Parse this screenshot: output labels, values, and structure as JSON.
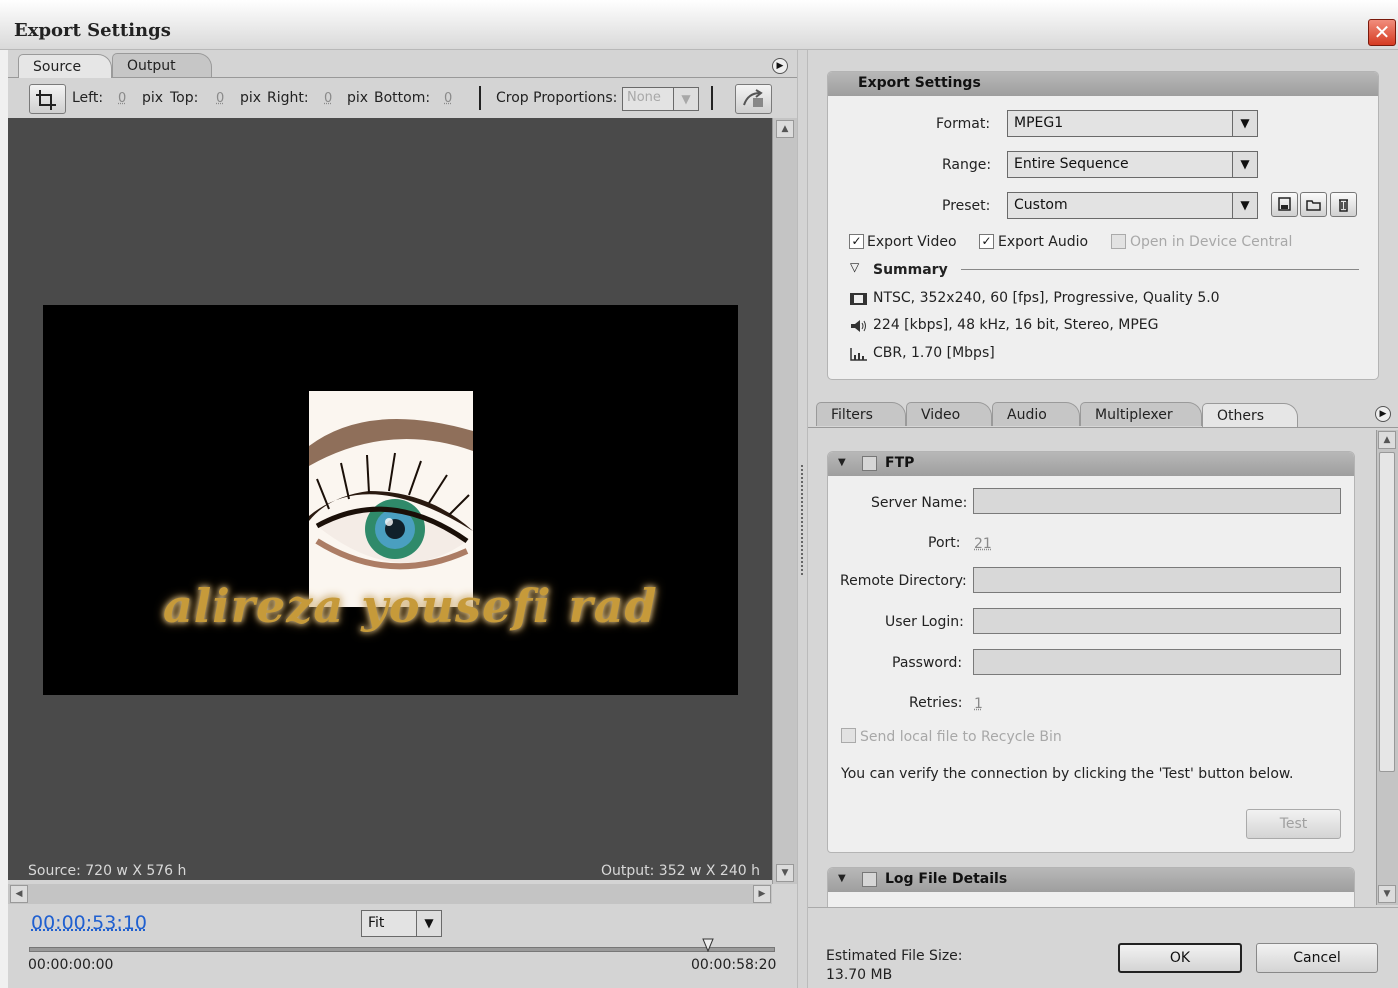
{
  "window": {
    "title": "Export Settings",
    "close_label": "✕"
  },
  "left": {
    "tabs": [
      {
        "label": "Source",
        "active": true
      },
      {
        "label": "Output",
        "active": false
      }
    ],
    "crop": {
      "left_label": "Left:",
      "left_value": "0",
      "pix1": "pix",
      "top_label": "Top:",
      "top_value": "0",
      "pix2": "pix",
      "right_label": "Right:",
      "right_value": "0",
      "pix3": "pix",
      "bottom_label": "Bottom:",
      "bottom_value": "0",
      "proportions_label": "Crop Proportions:",
      "proportions_value": "None"
    },
    "preview": {
      "watermark": "alireza yousefi rad",
      "source_info": "Source: 720 w X 576 h",
      "output_info": "Output: 352 w X 240 h"
    },
    "timeline": {
      "current_time": "00:00:53:10",
      "zoom_value": "Fit",
      "start_time": "00:00:00:00",
      "end_time": "00:00:58:20",
      "playhead_fraction": 0.91
    }
  },
  "right": {
    "export_settings": {
      "header": "Export Settings",
      "format_label": "Format:",
      "format_value": "MPEG1",
      "range_label": "Range:",
      "range_value": "Entire Sequence",
      "preset_label": "Preset:",
      "preset_value": "Custom",
      "export_video_label": "Export Video",
      "export_video_checked": true,
      "export_audio_label": "Export Audio",
      "export_audio_checked": true,
      "device_central_label": "Open in Device Central",
      "device_central_checked": false,
      "summary_label": "Summary",
      "summary_video": "NTSC, 352x240, 60 [fps], Progressive, Quality 5.0",
      "summary_audio": "224 [kbps], 48 kHz, 16 bit, Stereo, MPEG",
      "summary_bitrate": "CBR, 1.70 [Mbps]"
    },
    "tabs": [
      {
        "label": "Filters",
        "active": false
      },
      {
        "label": "Video",
        "active": false
      },
      {
        "label": "Audio",
        "active": false
      },
      {
        "label": "Multiplexer",
        "active": false
      },
      {
        "label": "Others",
        "active": true
      }
    ],
    "ftp": {
      "header": "FTP",
      "server_label": "Server Name:",
      "server_value": "",
      "port_label": "Port:",
      "port_value": "21",
      "remote_label": "Remote Directory:",
      "remote_value": "",
      "user_label": "User Login:",
      "user_value": "",
      "password_label": "Password:",
      "password_value": "",
      "retries_label": "Retries:",
      "retries_value": "1",
      "recycle_label": "Send local file to Recycle Bin",
      "hint": "You can verify the connection by clicking the 'Test' button below.",
      "test_label": "Test"
    },
    "log": {
      "header": "Log File Details"
    },
    "footer": {
      "size_label": "Estimated File Size:",
      "size_value": "13.70 MB",
      "ok_label": "OK",
      "cancel_label": "Cancel"
    }
  }
}
